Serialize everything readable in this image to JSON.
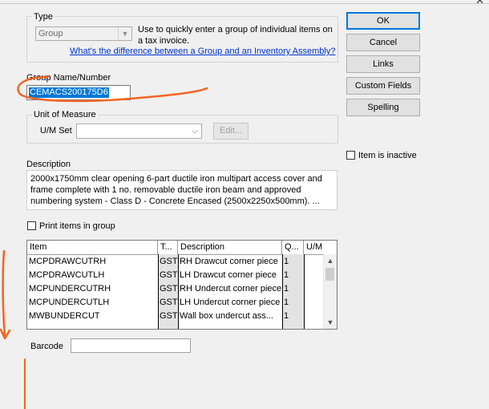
{
  "type_group": {
    "legend": "Type",
    "selected": "Group",
    "help_text": "Use to quickly enter a group of individual items on a tax invoice.",
    "link": "What's the difference between a Group and an Inventory Assembly?"
  },
  "group_name": {
    "label": "Group Name/Number",
    "value": "CEMACS200175D6"
  },
  "unit_of_measure": {
    "legend": "Unit of Measure",
    "um_set_label": "U/M Set",
    "um_set_value": "",
    "edit_label": "Edit..."
  },
  "description": {
    "label": "Description",
    "text": "2000x1750mm clear opening 6-part ductile iron multipart access cover and frame complete with 1 no. removable ductile iron beam and approved numbering system - Class D - Concrete Encased (2500x2250x500mm). ..."
  },
  "print_items_label": "Print items in group",
  "item_inactive_label": "Item is inactive",
  "buttons": {
    "ok": "OK",
    "cancel": "Cancel",
    "links": "Links",
    "custom_fields": "Custom Fields",
    "spelling": "Spelling"
  },
  "table": {
    "headers": [
      "Item",
      "T...",
      "Description",
      "Q...",
      "U/M"
    ],
    "rows": [
      {
        "item": "MCPDRAWCUTRH",
        "tax": "GST",
        "description": "RH Drawcut corner piece",
        "qty": "1",
        "um": ""
      },
      {
        "item": "MCPDRAWCUTLH",
        "tax": "GST",
        "description": "LH Drawcut corner piece",
        "qty": "1",
        "um": ""
      },
      {
        "item": "MCPUNDERCUTRH",
        "tax": "GST",
        "description": "RH Undercut corner piece",
        "qty": "1",
        "um": ""
      },
      {
        "item": "MCPUNDERCUTLH",
        "tax": "GST",
        "description": "LH Undercut corner piece",
        "qty": "1",
        "um": ""
      },
      {
        "item": "MWBUNDERCUT",
        "tax": "GST",
        "description": "Wall box undercut ass...",
        "qty": "1",
        "um": ""
      }
    ]
  },
  "barcode": {
    "label": "Barcode",
    "value": ""
  },
  "annotation_color": "#f26522"
}
